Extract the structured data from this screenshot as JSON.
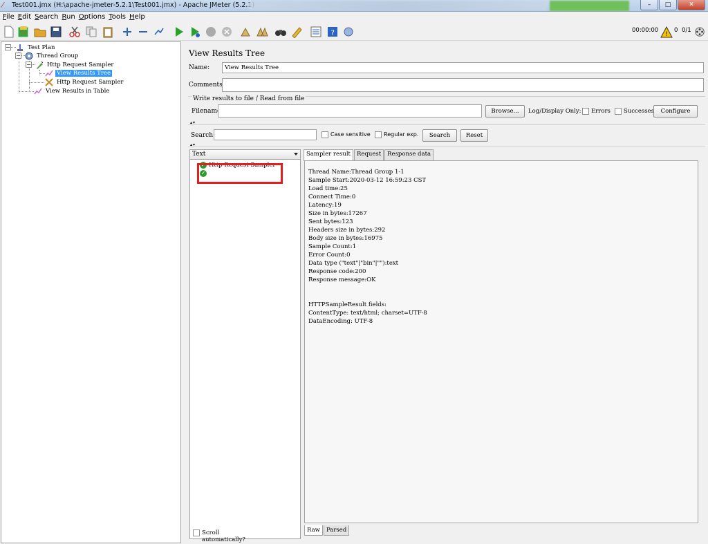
{
  "window": {
    "title": "Test001.jmx (H:\\apache-jmeter-5.2.1\\Test001.jmx) - Apache JMeter (5.2.1)",
    "controls": [
      "–",
      "□",
      "✕"
    ]
  },
  "menu": [
    {
      "label": "File",
      "key": "F",
      "rest": "ile"
    },
    {
      "label": "Edit",
      "key": "E",
      "rest": "dit"
    },
    {
      "label": "Search",
      "key": "S",
      "rest": "earch"
    },
    {
      "label": "Run",
      "key": "R",
      "rest": "un"
    },
    {
      "label": "Options",
      "key": "O",
      "rest": "ptions"
    },
    {
      "label": "Tools",
      "key": "T",
      "rest": "ools"
    },
    {
      "label": "Help",
      "key": "H",
      "rest": "elp"
    }
  ],
  "toolbar_status": {
    "elapsed": "00:00:00",
    "warnings": "0",
    "threads": "0/1"
  },
  "tree": {
    "test_plan": "Test Plan",
    "thread_group": "Thread Group",
    "http_sampler_1": "Http Request Sampler",
    "view_results_tree": "View Results Tree",
    "http_sampler_2": "Http Request Sampler",
    "view_results_table": "View Results in Table"
  },
  "panel": {
    "title": "View Results Tree",
    "name_label": "Name:",
    "name_value": "View Results Tree",
    "comments_label": "Comments:",
    "comments_value": "",
    "file_section": "Write results to file / Read from file",
    "filename_label": "Filename",
    "filename_value": "",
    "browse": "Browse...",
    "log_display_only": "Log/Display Only:",
    "errors": "Errors",
    "successes": "Successes",
    "configure": "Configure",
    "search_label": "Search:",
    "search_value": "",
    "case_sensitive": "Case sensitive",
    "regular_exp": "Regular exp.",
    "search_button": "Search",
    "reset_button": "Reset",
    "renderer": "Text",
    "scroll_auto": "Scroll automatically?"
  },
  "results": [
    {
      "label": "Http Request Sampler"
    },
    {
      "label": ""
    }
  ],
  "tabs": [
    "Sampler result",
    "Request",
    "Response data"
  ],
  "sampler_result": [
    "Thread Name:Thread Group 1-1",
    "Sample Start:2020-03-12 16:59:23 CST",
    "Load time:25",
    "Connect Time:0",
    "Latency:19",
    "Size in bytes:17267",
    "Sent bytes:123",
    "Headers size in bytes:292",
    "Body size in bytes:16975",
    "Sample Count:1",
    "Error Count:0",
    "Data type (\"text\"|\"bin\"|\"\"):text",
    "Response code:200",
    "Response message:OK",
    "",
    "",
    "HTTPSampleResult fields:",
    "ContentType: text/html; charset=UTF-8",
    "DataEncoding: UTF-8"
  ],
  "bottom_tabs": [
    "Raw",
    "Parsed"
  ],
  "colors": {
    "selection": "#3399ff",
    "highlight_box": "#e01f1f",
    "ok_icon": "#2c9a2c"
  }
}
